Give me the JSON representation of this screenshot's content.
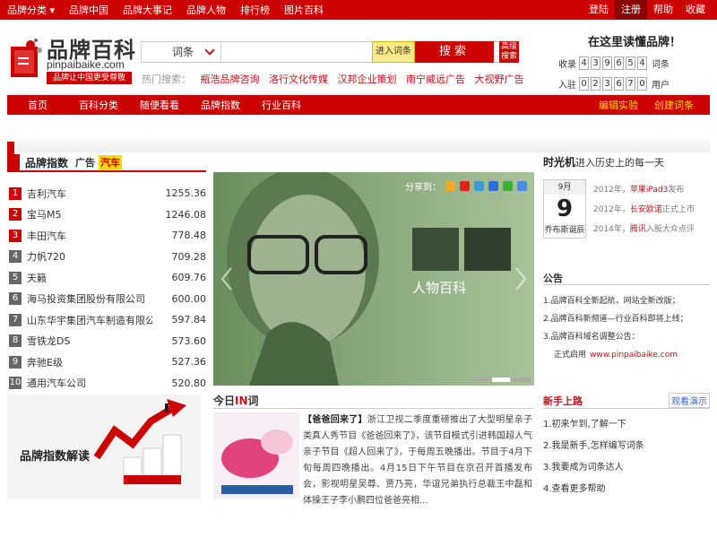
{
  "topbar": {
    "nav": [
      "品牌分类 ▾",
      "品牌中国",
      "品牌大事记",
      "品牌人物",
      "排行榜",
      "图片百科"
    ],
    "right": [
      "登陆",
      "注册",
      "帮助",
      "收藏"
    ]
  },
  "logo": {
    "cn": "品牌百科",
    "url": "pinpaibaike.com",
    "slogan": "品牌让中国更受尊敬"
  },
  "search": {
    "select": "词条",
    "enter_btn": "进入词条",
    "search_btn": "搜索",
    "adv": "高级搜索",
    "hot_label": "热门搜索：",
    "hot": [
      "瓶浩品牌咨询",
      "洛行文化传媒",
      "汉邦企业策划",
      "南宁威远广告",
      "大视野广告"
    ]
  },
  "counter": {
    "title": "在这里读懂品牌！",
    "row1_label": "收录",
    "row1_digits": [
      "4",
      "3",
      "9",
      "6",
      "5",
      "4"
    ],
    "row1_unit": "词条",
    "row2_label": "入驻",
    "row2_digits": [
      "0",
      "2",
      "3",
      "6",
      "7",
      "0"
    ],
    "row2_unit": "用户"
  },
  "mainnav": {
    "items": [
      "首页",
      "百科分类",
      "随便看看",
      "品牌指数",
      "行业百科"
    ],
    "right": [
      "编辑实验",
      "创建词条"
    ]
  },
  "brand_index": {
    "title": "品牌指数",
    "ad": "广告",
    "tag": "汽车",
    "items": [
      {
        "rank": "1",
        "name": "吉利汽车",
        "value": "1255.36"
      },
      {
        "rank": "2",
        "name": "宝马M5",
        "value": "1246.08"
      },
      {
        "rank": "3",
        "name": "丰田汽车",
        "value": "778.48"
      },
      {
        "rank": "4",
        "name": "力帆720",
        "value": "709.28"
      },
      {
        "rank": "5",
        "name": "天籁",
        "value": "609.76"
      },
      {
        "rank": "6",
        "name": "海马投资集团股份有限公司",
        "value": "600.00"
      },
      {
        "rank": "7",
        "name": "山东华宇集团汽车制造有限公司",
        "value": "597.84"
      },
      {
        "rank": "8",
        "name": "雪铁龙DS",
        "value": "573.60"
      },
      {
        "rank": "9",
        "name": "奔驰E级",
        "value": "527.36"
      },
      {
        "rank": "10",
        "name": "通用汽车公司",
        "value": "520.80"
      }
    ],
    "banner": "品牌指数解读"
  },
  "slider": {
    "share": "分享到：",
    "caption": "人物百科"
  },
  "today": {
    "title_a": "今日",
    "title_b": "IN",
    "title_c": "词",
    "headline": "【爸爸回来了】",
    "body": "浙江卫视二季度重磅推出了大型明星亲子类真人秀节目《爸爸回来了》，该节目模式引进韩国超人气亲子节目《超人回来了》，于每周五晚播出。节目于4月下旬每周四晚播出。4月15日下午节目在京召开首播发布会，影视明星吴尊、贾乃亮，华谊兄弟执行总裁王中磊和体操王子李小鹏四位爸爸亮相..."
  },
  "timeline": {
    "title": "时光机",
    "sub": "进入历史上的每一天",
    "month": "9月",
    "day": "9",
    "name": "乔布斯诞辰",
    "events": [
      {
        "year": "2012年，",
        "key": "苹果iPad3",
        "rest": "发布"
      },
      {
        "year": "2012年，",
        "key": "长安欧诺",
        "rest": "正式上市"
      },
      {
        "year": "2014年，",
        "key": "腾讯",
        "rest": "入股大众点评"
      }
    ]
  },
  "notice": {
    "title": "公告",
    "lines": [
      "1.品牌百科全新起航，网站全新改版；",
      "2.品牌百科新频道—行业百科即将上线；",
      "3.品牌百科域名调整公告："
    ],
    "url_label": "正式启用",
    "url": "www.pinpaibaike.com"
  },
  "newbie": {
    "title": "新手上路",
    "more": "观看演示",
    "items": [
      "1.初来乍到,了解一下",
      "2.我是新手,怎样编写词条",
      "3.我要成为词条达人",
      "4.查看更多帮助"
    ]
  }
}
